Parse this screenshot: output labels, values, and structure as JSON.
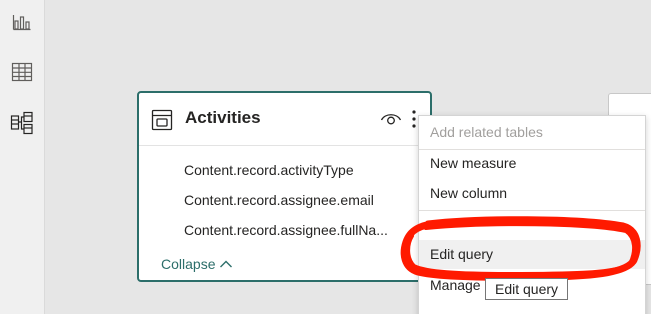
{
  "rail": {
    "items": [
      {
        "name": "report-view",
        "icon": "bar-chart-icon"
      },
      {
        "name": "data-view",
        "icon": "table-grid-icon"
      },
      {
        "name": "model-view",
        "icon": "model-diagram-icon"
      }
    ]
  },
  "card": {
    "title": "Activities",
    "fields": [
      "Content.record.activityType",
      "Content.record.assignee.email",
      "Content.record.assignee.fullNa..."
    ],
    "collapse_label": "Collapse",
    "border_color": "#2c6e6a"
  },
  "menu": {
    "items": [
      {
        "label": "Add related tables",
        "disabled": true
      },
      {
        "label": "New measure",
        "disabled": false
      },
      {
        "label": "New column",
        "disabled": false
      },
      {
        "label": "Edit query",
        "disabled": false,
        "hover": true
      },
      {
        "label": "Manage",
        "disabled": false
      }
    ]
  },
  "tooltip": {
    "text": "Edit query"
  },
  "annotation": {
    "color": "#ff1a00",
    "target": "Edit query"
  }
}
